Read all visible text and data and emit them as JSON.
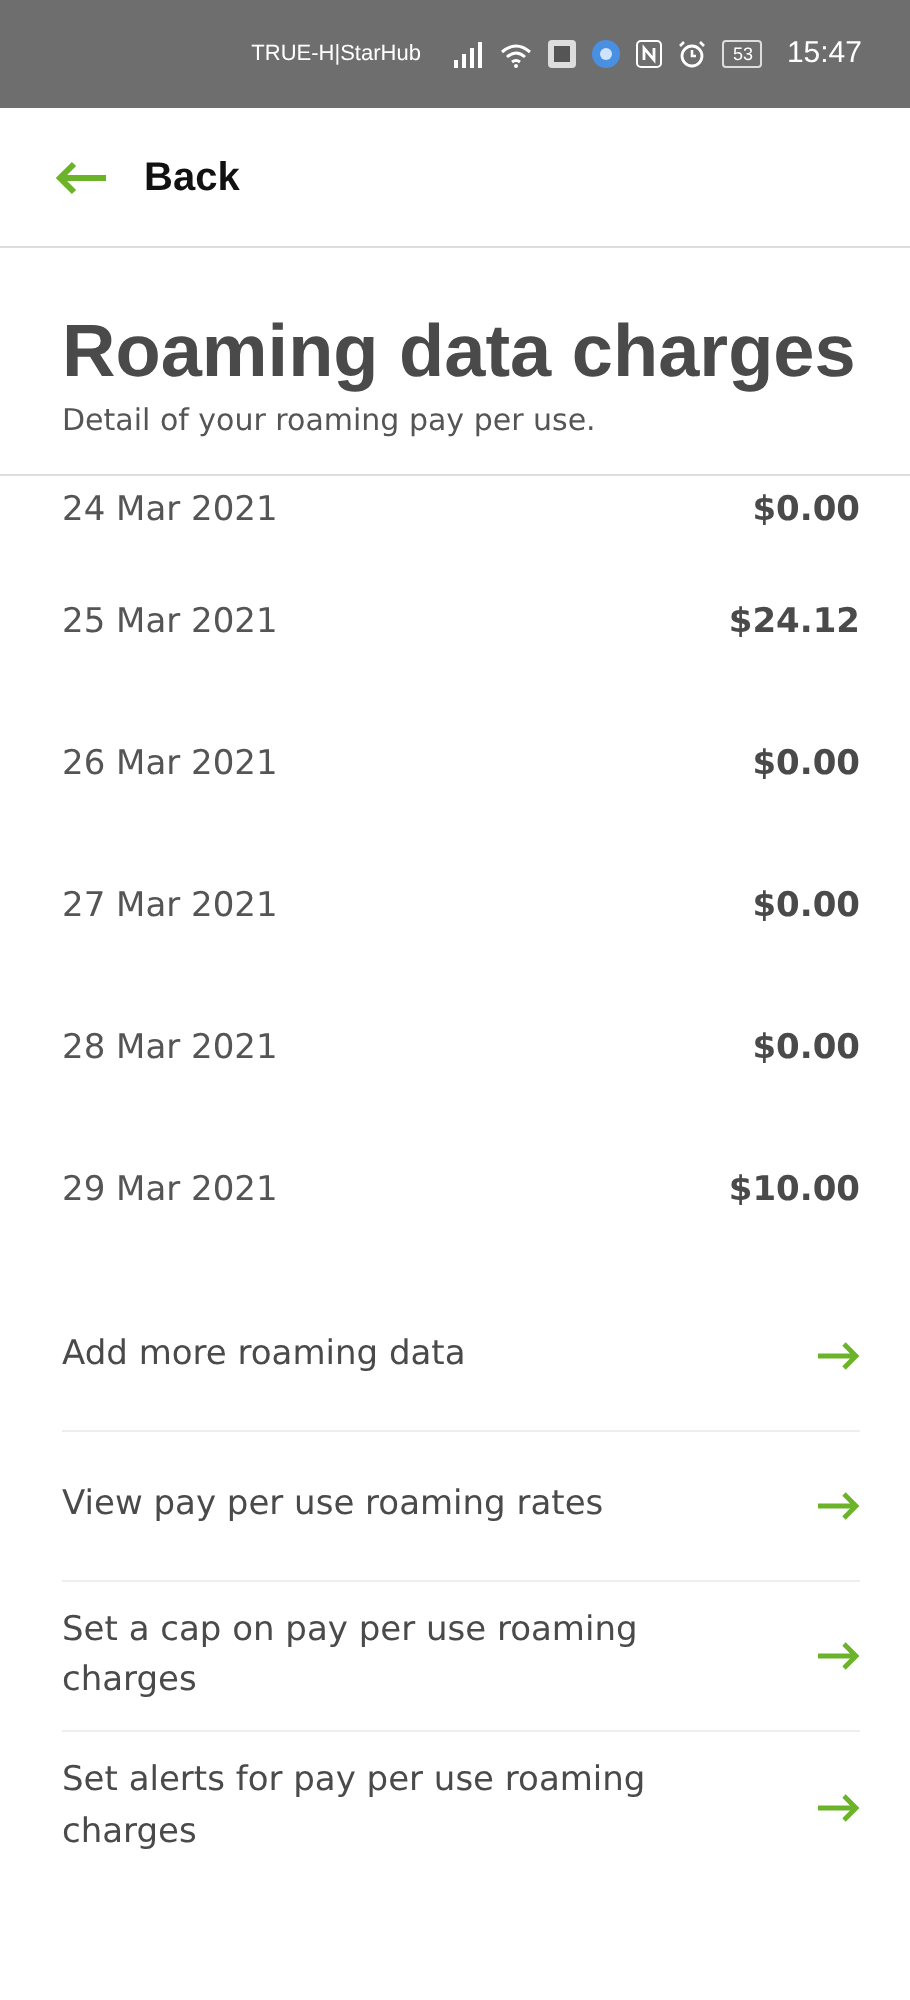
{
  "status_bar": {
    "carrier": "TRUE-H|StarHub",
    "battery": "53",
    "time": "15:47"
  },
  "header": {
    "back_label": "Back"
  },
  "title": "Roaming data charges",
  "subtitle": "Detail of your roaming pay per use.",
  "charges": [
    {
      "date": "24 Mar 2021",
      "amount": "$0.00"
    },
    {
      "date": "25 Mar 2021",
      "amount": "$24.12"
    },
    {
      "date": "26 Mar 2021",
      "amount": "$0.00"
    },
    {
      "date": "27 Mar 2021",
      "amount": "$0.00"
    },
    {
      "date": "28 Mar 2021",
      "amount": "$0.00"
    },
    {
      "date": "29 Mar 2021",
      "amount": "$10.00"
    }
  ],
  "links": [
    {
      "label": "Add more roaming data"
    },
    {
      "label": "View pay per use roaming rates"
    },
    {
      "label": "Set a cap on pay per use roaming charges"
    },
    {
      "label": "Set alerts for pay per use roaming charges"
    }
  ]
}
